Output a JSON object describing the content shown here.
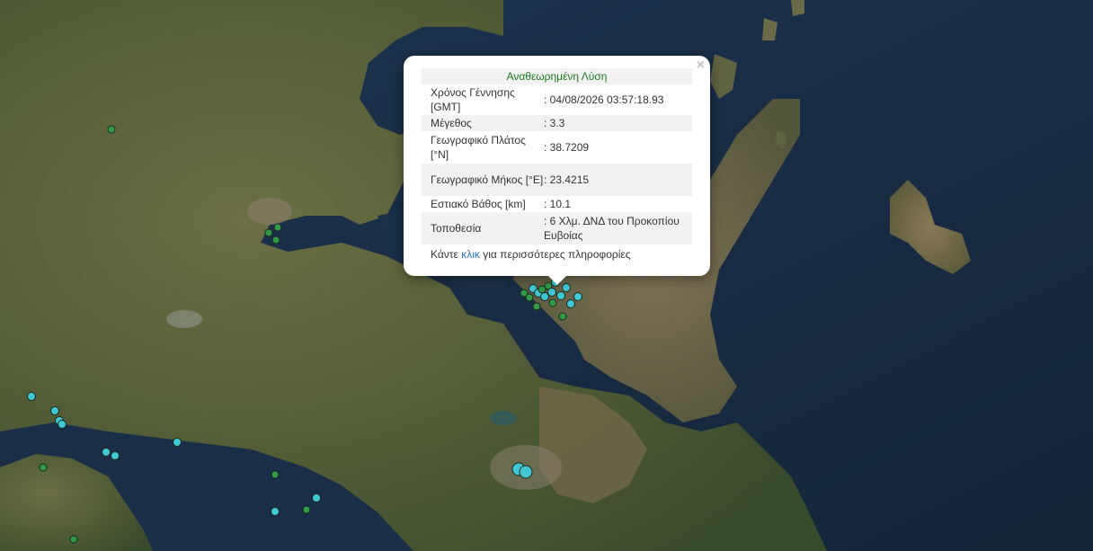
{
  "popup": {
    "title": "Αναθεωρημένη Λύση",
    "close": "×",
    "rows": [
      {
        "label": "Χρόνος Γέννησης [GMT]",
        "value": ": 04/08/2026 03:57:18.93"
      },
      {
        "label": "Μέγεθος",
        "value": ": 3.3"
      },
      {
        "label": "Γεωγραφικό Πλάτος [°N]",
        "value": ": 38.7209"
      },
      {
        "label": "Γεωγραφικό Μήκος [°E]",
        "value": ": 23.4215"
      },
      {
        "label": "Εστιακό Βάθος [km]",
        "value": ": 10.1"
      },
      {
        "label": "Τοποθεσία",
        "value": ": 6 Χλμ. ΔΝΔ του Προκοπίου Ευβοίας"
      }
    ],
    "footer_prefix": "Κάντε ",
    "footer_link": "κλικ",
    "footer_suffix": " για περισσότερες πληροφορίες"
  },
  "map": {
    "colors": {
      "recent_marker": "#3fc7d4",
      "older_marker": "#2f9a4a",
      "sea": "#1a2a3e",
      "land": "#4d5a38"
    }
  }
}
